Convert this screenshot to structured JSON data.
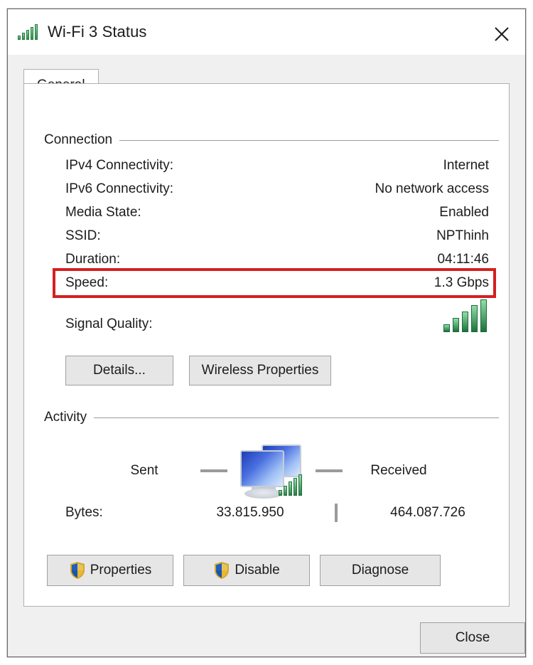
{
  "window": {
    "title": "Wi-Fi 3 Status",
    "title_icon": "signal-bars-icon",
    "close_icon": "close-icon"
  },
  "tabs": [
    {
      "label": "General",
      "selected": true
    }
  ],
  "connection": {
    "group_label": "Connection",
    "rows": [
      {
        "label": "IPv4 Connectivity:",
        "value": "Internet"
      },
      {
        "label": "IPv6 Connectivity:",
        "value": "No network access"
      },
      {
        "label": "Media State:",
        "value": "Enabled"
      },
      {
        "label": "SSID:",
        "value": "NPThinh"
      },
      {
        "label": "Duration:",
        "value": "04:11:46"
      },
      {
        "label": "Speed:",
        "value": "1.3 Gbps",
        "highlighted": true
      }
    ],
    "signal_quality": {
      "label": "Signal Quality:",
      "bars_filled": 5,
      "bars_total": 5
    },
    "buttons": {
      "details": "Details...",
      "wireless_properties": "Wireless Properties"
    }
  },
  "activity": {
    "group_label": "Activity",
    "sent_label": "Sent",
    "received_label": "Received",
    "bytes_label": "Bytes:",
    "bytes_sent": "33.815.950",
    "bytes_received": "464.087.726"
  },
  "actions": {
    "properties": "Properties",
    "disable": "Disable",
    "diagnose": "Diagnose",
    "close": "Close"
  },
  "colors": {
    "highlight": "#d32020",
    "signal_green": "#2f8f4e",
    "dialog_bg": "#f0f0f0",
    "panel_bg": "#ffffff",
    "shield_blue": "#1f5fbf",
    "shield_gold": "#e8b830"
  }
}
